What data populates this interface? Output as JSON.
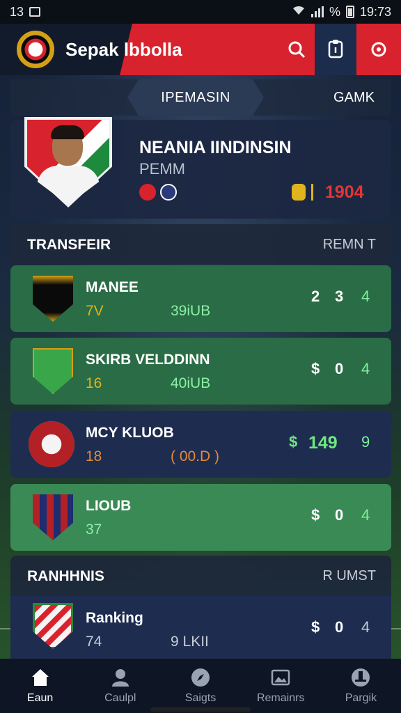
{
  "status_bar": {
    "time_left": "13",
    "battery_pct": "%",
    "time_right": "19:73"
  },
  "app_bar": {
    "title": "Sepak lbbolla"
  },
  "tabs": {
    "active": "IPEMASIN",
    "other": "GAMK"
  },
  "player": {
    "name": "NEANIA IINDINSIN",
    "position": "PEMM",
    "score": "1904"
  },
  "transfer": {
    "title": "TRANSFEIR",
    "right": "REMN T",
    "rows": [
      {
        "name": "MANEE",
        "num": "7V",
        "value": "39iUB",
        "a": "2",
        "b": "3",
        "c": "4"
      },
      {
        "name": "SKIRB VELDDINN",
        "num": "16",
        "value": "40iUB",
        "a": "$",
        "b": "0",
        "c": "4"
      },
      {
        "name": "MCY KLUOB",
        "num": "18",
        "value": "( 00.D )",
        "a": "$",
        "b": "149",
        "c": "9"
      },
      {
        "name": "LIOUB",
        "num": "37",
        "value": "",
        "a": "$",
        "b": "0",
        "c": "4"
      }
    ]
  },
  "ranking": {
    "title": "RANHHNIS",
    "right": "R UMST",
    "row": {
      "name": "Ranking",
      "num": "74",
      "value": "9 LKII",
      "a": "$",
      "b": "0",
      "c": "4"
    }
  },
  "bottom_nav": [
    {
      "label": "Eaun",
      "icon": "home-icon"
    },
    {
      "label": "Caulpl",
      "icon": "person-icon"
    },
    {
      "label": "Saigts",
      "icon": "compass-icon"
    },
    {
      "label": "Remainrs",
      "icon": "image-icon"
    },
    {
      "label": "Pargik",
      "icon": "profile-icon"
    }
  ],
  "colors": {
    "accent_red": "#d8232e",
    "row_green": "#2a6c46",
    "row_blue": "#1e2c50",
    "score_red": "#e53535"
  }
}
